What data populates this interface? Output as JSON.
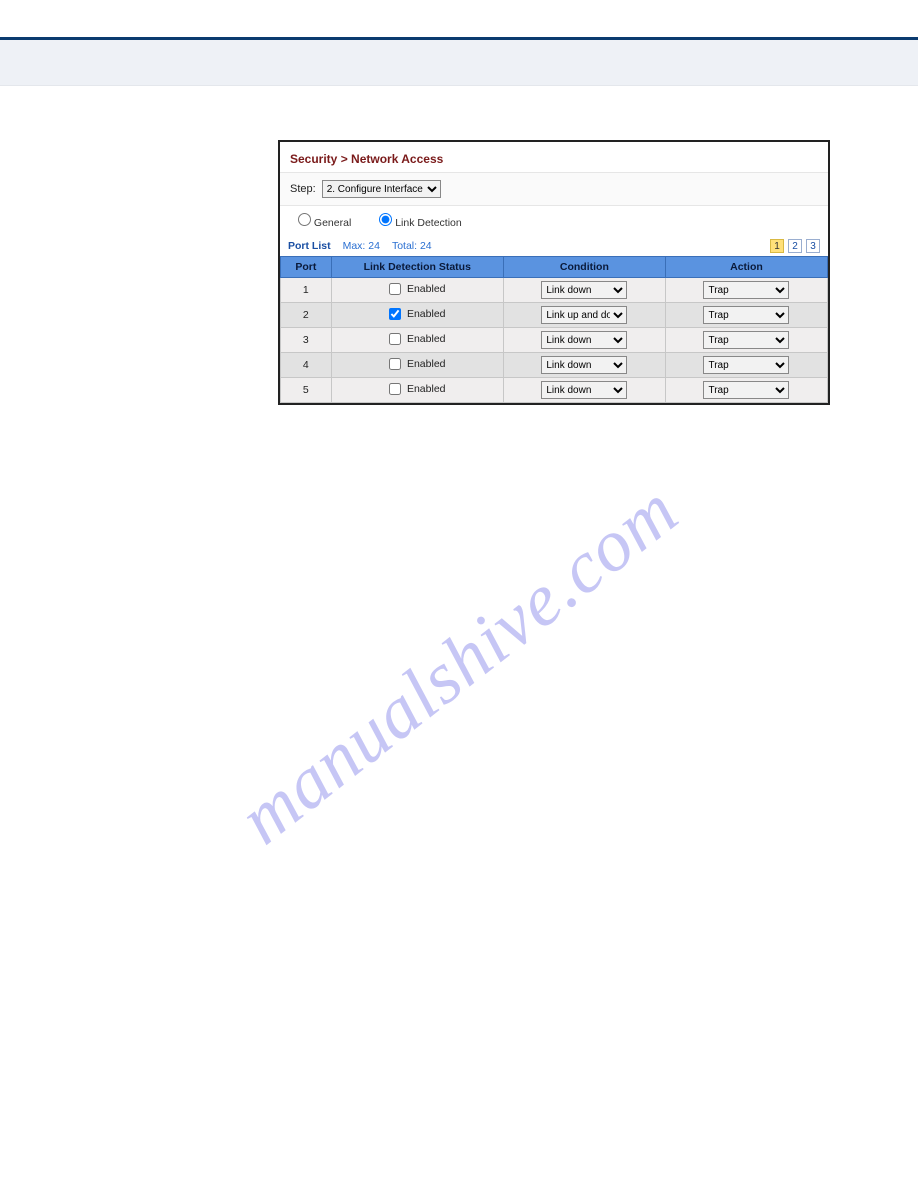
{
  "watermark": "manualshive.com",
  "breadcrumb": "Security > Network Access",
  "step": {
    "label": "Step:",
    "options": [
      "2. Configure Interface"
    ],
    "selected": "2. Configure Interface"
  },
  "radios": {
    "general": "General",
    "link_detection": "Link Detection"
  },
  "portlist": {
    "title": "Port List",
    "max_label": "Max: 24",
    "total_label": "Total: 24"
  },
  "pager": {
    "pages": [
      "1",
      "2",
      "3"
    ],
    "active": "1"
  },
  "table": {
    "headers": {
      "port": "Port",
      "status": "Link Detection Status",
      "condition": "Condition",
      "action": "Action"
    },
    "status_checkbox_label": "Enabled",
    "condition_options": [
      "Link down",
      "Link up and down"
    ],
    "action_options": [
      "Trap"
    ],
    "rows": [
      {
        "port": "1",
        "checked": false,
        "condition": "Link down",
        "action": "Trap"
      },
      {
        "port": "2",
        "checked": true,
        "condition": "Link up and down",
        "action": "Trap"
      },
      {
        "port": "3",
        "checked": false,
        "condition": "Link down",
        "action": "Trap"
      },
      {
        "port": "4",
        "checked": false,
        "condition": "Link down",
        "action": "Trap"
      },
      {
        "port": "5",
        "checked": false,
        "condition": "Link down",
        "action": "Trap"
      }
    ]
  }
}
